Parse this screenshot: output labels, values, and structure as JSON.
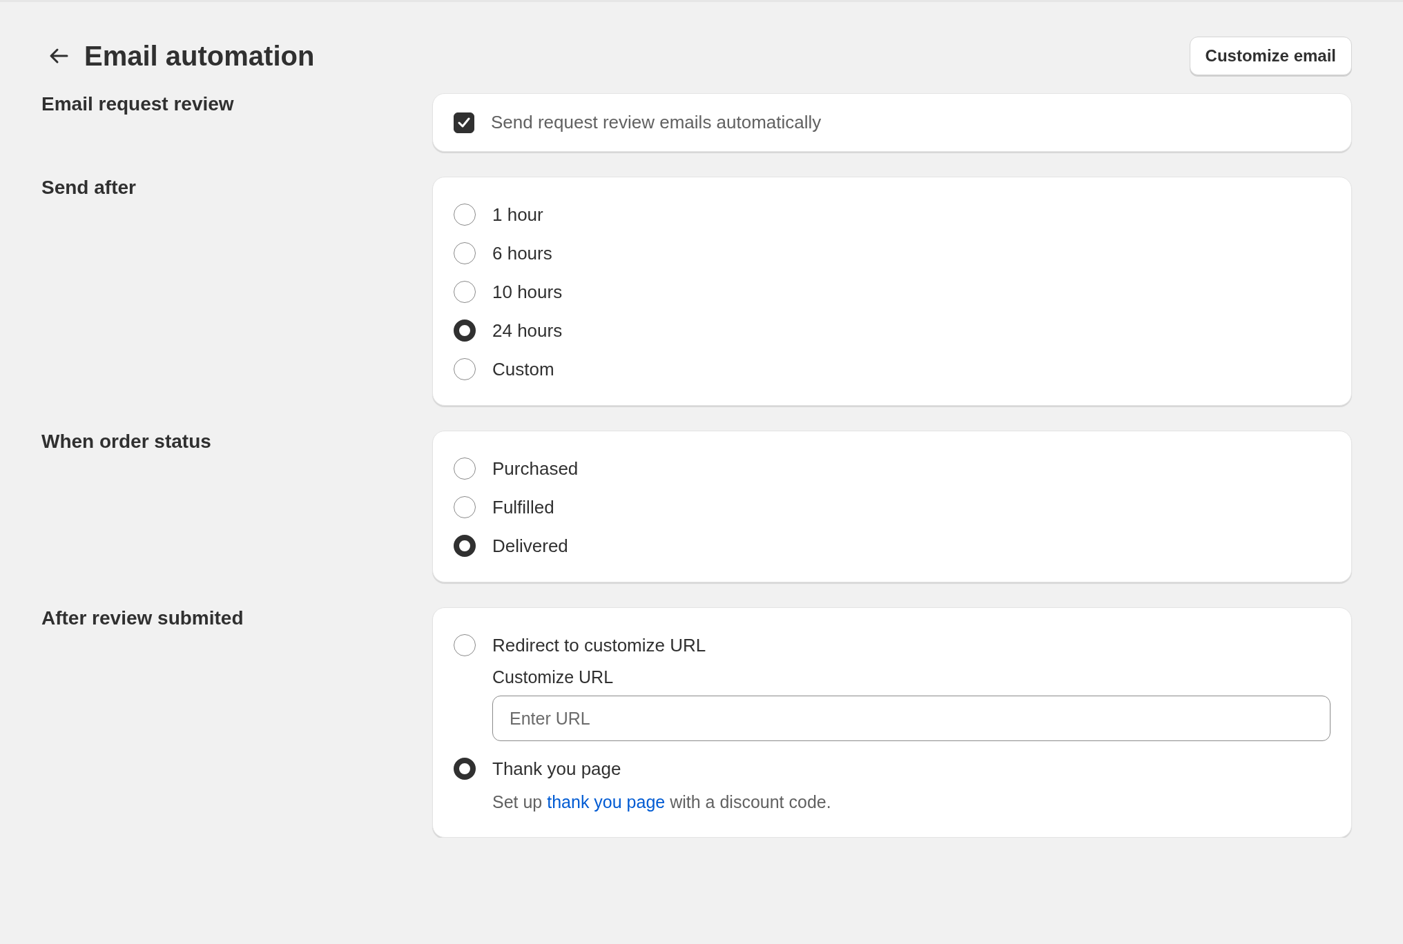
{
  "header": {
    "title": "Email automation",
    "button": "Customize email"
  },
  "sections": [
    {
      "label": "Email request review",
      "kind": "checkbox",
      "checkbox": {
        "label": "Send request review emails automatically",
        "checked": true
      }
    },
    {
      "label": "Send after",
      "kind": "radio",
      "options": [
        {
          "label": "1 hour",
          "selected": false
        },
        {
          "label": "6 hours",
          "selected": false
        },
        {
          "label": "10 hours",
          "selected": false
        },
        {
          "label": "24 hours",
          "selected": true
        },
        {
          "label": "Custom",
          "selected": false
        }
      ]
    },
    {
      "label": "When order status",
      "kind": "radio",
      "options": [
        {
          "label": "Purchased",
          "selected": false
        },
        {
          "label": "Fulfilled",
          "selected": false
        },
        {
          "label": "Delivered",
          "selected": true
        }
      ]
    },
    {
      "label": "After review submited",
      "kind": "radio",
      "options": [
        {
          "label": "Redirect to customize URL",
          "selected": false,
          "field": {
            "label": "Customize URL",
            "placeholder": "Enter URL"
          }
        },
        {
          "label": "Thank you page",
          "selected": true,
          "note": {
            "before": "Set up ",
            "link": "thank you page",
            "after": " with a discount code."
          }
        }
      ]
    }
  ]
}
